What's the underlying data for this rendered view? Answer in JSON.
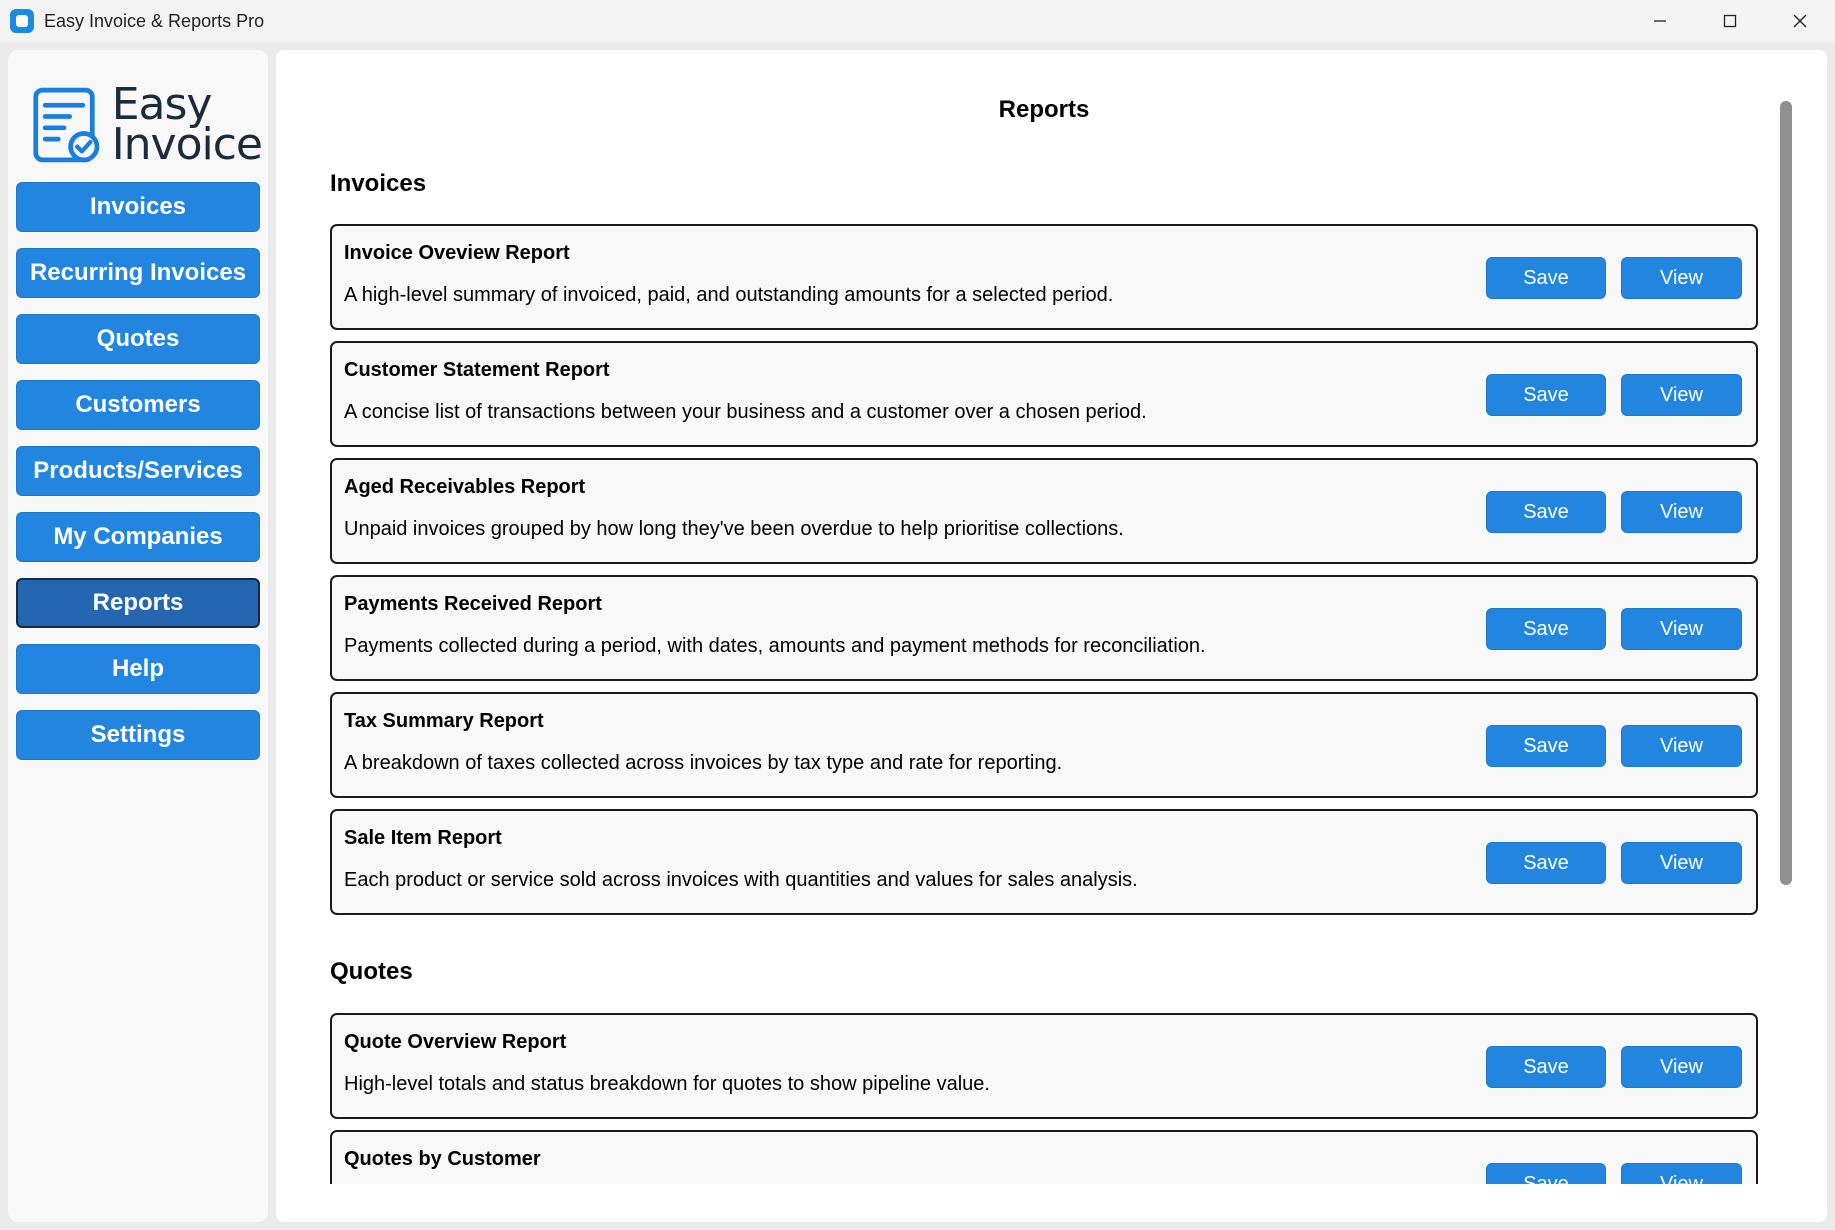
{
  "window": {
    "title": "Easy Invoice & Reports Pro",
    "icon": "app-icon",
    "controls": [
      "minimize-icon",
      "maximize-icon",
      "close-icon"
    ]
  },
  "sidebar": {
    "logo": {
      "line1": "Easy",
      "line2": "Invoice",
      "icon": "invoice-document-icon"
    },
    "items": [
      {
        "label": "Invoices"
      },
      {
        "label": "Recurring Invoices"
      },
      {
        "label": "Quotes"
      },
      {
        "label": "Customers"
      },
      {
        "label": "Products/Services"
      },
      {
        "label": "My Companies"
      },
      {
        "label": "Reports",
        "active": true
      },
      {
        "label": "Help"
      },
      {
        "label": "Settings"
      }
    ]
  },
  "main": {
    "title": "Reports",
    "sections": [
      {
        "title": "Invoices",
        "reports": [
          {
            "title": "Invoice Oveview Report",
            "description": "A high-level summary of invoiced, paid, and outstanding amounts for a selected period.",
            "save": "Save",
            "view": "View"
          },
          {
            "title": "Customer Statement Report",
            "description": "A concise list of transactions between your business and a customer over a chosen period.",
            "save": "Save",
            "view": "View"
          },
          {
            "title": "Aged Receivables Report",
            "description": "Unpaid invoices grouped by how long they've been overdue to help prioritise collections.",
            "save": "Save",
            "view": "View"
          },
          {
            "title": "Payments Received Report",
            "description": "Payments collected during a period, with dates, amounts and payment methods for reconciliation.",
            "save": "Save",
            "view": "View"
          },
          {
            "title": "Tax Summary Report",
            "description": "A breakdown of taxes collected across invoices by tax type and rate for reporting.",
            "save": "Save",
            "view": "View"
          },
          {
            "title": "Sale Item Report",
            "description": "Each product or service sold across invoices with quantities and values for sales analysis.",
            "save": "Save",
            "view": "View"
          }
        ]
      },
      {
        "title": "Quotes",
        "reports": [
          {
            "title": "Quote Overview Report",
            "description": "High-level totals and status breakdown for quotes to show pipeline value.",
            "save": "Save",
            "view": "View"
          },
          {
            "title": "Quotes by Customer",
            "description": "",
            "save": "Save",
            "view": "View"
          }
        ]
      }
    ]
  },
  "colors": {
    "accent": "#2286e0",
    "active_nav": "#2467b0",
    "card_border": "#1b1b1b",
    "card_bg": "#f8f8f8"
  }
}
